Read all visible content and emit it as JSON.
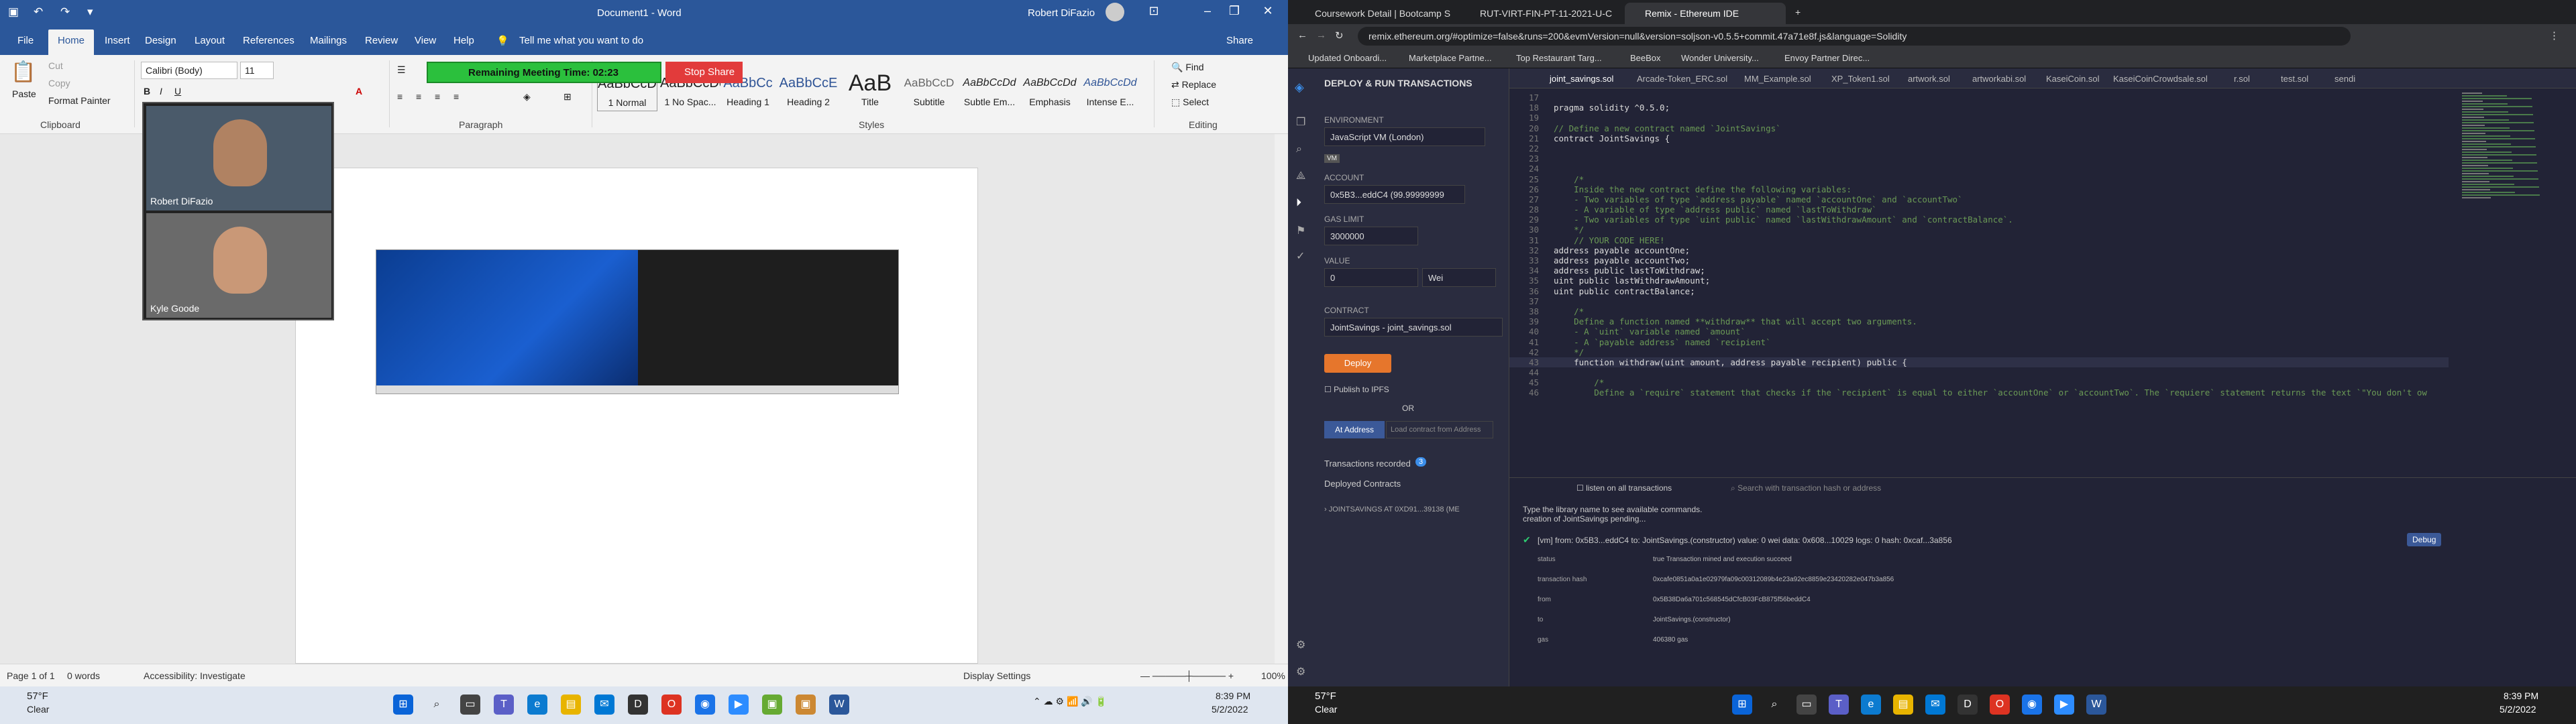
{
  "word": {
    "title": "Document1 - Word",
    "user": "Robert DiFazio",
    "tabs": [
      "File",
      "Home",
      "Insert",
      "Design",
      "Layout",
      "References",
      "Mailings",
      "Review",
      "View",
      "Help"
    ],
    "tell_me": "Tell me what you want to do",
    "share": "Share",
    "clipboard": {
      "paste": "Paste",
      "cut": "Cut",
      "copy": "Copy",
      "format_painter": "Format Painter",
      "group": "Clipboard"
    },
    "font": {
      "name": "Calibri (Body)",
      "size": "11"
    },
    "paragraph_group": "Paragraph",
    "styles_group": "Styles",
    "editing": {
      "find": "Find",
      "replace": "Replace",
      "select": "Select",
      "group": "Editing"
    },
    "styles": [
      {
        "preview": "AaBbCcDc",
        "name": "1 Normal"
      },
      {
        "preview": "AaBbCcDc",
        "name": "1 No Spac..."
      },
      {
        "preview": "AaBbCc",
        "name": "Heading 1"
      },
      {
        "preview": "AaBbCcE",
        "name": "Heading 2"
      },
      {
        "preview": "AaB",
        "name": "Title"
      },
      {
        "preview": "AaBbCcD",
        "name": "Subtitle"
      },
      {
        "preview": "AaBbCcDd",
        "name": "Subtle Em..."
      },
      {
        "preview": "AaBbCcDd",
        "name": "Emphasis"
      },
      {
        "preview": "AaBbCcDd",
        "name": "Intense E..."
      }
    ],
    "meeting_time": "Remaining Meeting Time: 02:23",
    "stop_share": "Stop Share",
    "participants": [
      "Robert DiFazio",
      "Kyle Goode"
    ],
    "status": {
      "page": "Page 1 of 1",
      "words": "0 words",
      "accessibility": "Accessibility: Investigate",
      "display": "Display Settings",
      "zoom": "100%"
    }
  },
  "taskbar_left": {
    "weather_temp": "57°F",
    "weather_desc": "Clear",
    "time": "8:39 PM",
    "date": "5/2/2022"
  },
  "taskbar_right": {
    "weather_temp": "57°F",
    "weather_desc": "Clear",
    "time": "8:39 PM",
    "date": "5/2/2022"
  },
  "chrome": {
    "tabs": [
      "Coursework Detail | Bootcamp S",
      "RUT-VIRT-FIN-PT-11-2021-U-C",
      "Remix - Ethereum IDE"
    ],
    "url": "remix.ethereum.org/#optimize=false&runs=200&evmVersion=null&version=soljson-v0.5.5+commit.47a71e8f.js&language=Solidity",
    "bookmarks": [
      "Updated Onboardi...",
      "Marketplace Partne...",
      "Top Restaurant Targ...",
      "BeeBox",
      "Wonder University...",
      "Envoy Partner Direc..."
    ]
  },
  "remix": {
    "panel_title": "DEPLOY & RUN TRANSACTIONS",
    "environment_label": "ENVIRONMENT",
    "environment": "JavaScript VM (London)",
    "vm_badge": "VM",
    "account_label": "ACCOUNT",
    "account": "0x5B3...eddC4 (99.99999999",
    "gas_label": "GAS LIMIT",
    "gas": "3000000",
    "value_label": "VALUE",
    "value": "0",
    "value_unit": "Wei",
    "contract_label": "CONTRACT",
    "contract": "JointSavings - joint_savings.sol",
    "deploy": "Deploy",
    "publish": "Publish to IPFS",
    "or": "OR",
    "at_address": "At Address",
    "load_contract": "Load contract from Address",
    "tx_recorded": "Transactions recorded",
    "tx_count": "3",
    "deployed": "Deployed Contracts",
    "deployed_item": "JOINTSAVINGS AT 0XD91...39138 (ME",
    "editor_tabs": [
      "joint_savings.sol",
      "Arcade-Token_ERC.sol",
      "MM_Example.sol",
      "XP_Token1.sol",
      "artwork.sol",
      "artworkabi.sol",
      "KaseiCoin.sol",
      "KaseiCoinCrowdsale.sol",
      "r.sol",
      "test.sol",
      "sendi"
    ],
    "code": [
      {
        "n": "17",
        "t": ""
      },
      {
        "n": "18",
        "t": "pragma solidity ^0.5.0;",
        "k": "kw"
      },
      {
        "n": "19",
        "t": ""
      },
      {
        "n": "20",
        "t": "// Define a new contract named `JointSavings`",
        "k": "cm"
      },
      {
        "n": "21",
        "t": "contract JointSavings {",
        "k": "kw"
      },
      {
        "n": "22",
        "t": ""
      },
      {
        "n": "23",
        "t": ""
      },
      {
        "n": "24",
        "t": ""
      },
      {
        "n": "25",
        "t": "    /*",
        "k": "cm"
      },
      {
        "n": "26",
        "t": "    Inside the new contract define the following variables:",
        "k": "cm"
      },
      {
        "n": "27",
        "t": "    - Two variables of type `address payable` named `accountOne` and `accountTwo`",
        "k": "cm"
      },
      {
        "n": "28",
        "t": "    - A variable of type `address public` named `lastToWithdraw`",
        "k": "cm"
      },
      {
        "n": "29",
        "t": "    - Two variables of type `uint public` named `lastWithdrawAmount` and `contractBalance`.",
        "k": "cm"
      },
      {
        "n": "30",
        "t": "    */",
        "k": "cm"
      },
      {
        "n": "31",
        "t": "    // YOUR CODE HERE!",
        "k": "cm"
      },
      {
        "n": "32",
        "t": "address payable accountOne;",
        "k": "kw"
      },
      {
        "n": "33",
        "t": "address payable accountTwo;",
        "k": "kw"
      },
      {
        "n": "34",
        "t": "address public lastToWithdraw;",
        "k": "kw"
      },
      {
        "n": "35",
        "t": "uint public lastWithdrawAmount;",
        "k": "kw"
      },
      {
        "n": "36",
        "t": "uint public contractBalance;",
        "k": "kw"
      },
      {
        "n": "37",
        "t": ""
      },
      {
        "n": "38",
        "t": "    /*",
        "k": "cm"
      },
      {
        "n": "39",
        "t": "    Define a function named **withdraw** that will accept two arguments.",
        "k": "cm"
      },
      {
        "n": "40",
        "t": "    - A `uint` variable named `amount`",
        "k": "cm"
      },
      {
        "n": "41",
        "t": "    - A `payable address` named `recipient`",
        "k": "cm"
      },
      {
        "n": "42",
        "t": "    */",
        "k": "cm"
      },
      {
        "n": "43",
        "t": "    function withdraw(uint amount, address payable recipient) public {",
        "k": "kw"
      },
      {
        "n": "44",
        "t": ""
      },
      {
        "n": "45",
        "t": "        /*",
        "k": "cm"
      },
      {
        "n": "46",
        "t": "        Define a `require` statement that checks if the `recipient` is equal to either `accountOne` or `accountTwo`. The `requiere` statement returns the text `\"You don't ow",
        "k": "cm"
      }
    ],
    "terminal": {
      "listen": "listen on all transactions",
      "search": "Search with transaction hash or address",
      "help1": "Type the library name to see available commands.",
      "help2": "creation of JointSavings pending...",
      "vm_line": "[vm]  from: 0x5B3...eddC4 to: JointSavings.(constructor) value: 0 wei data: 0x608...10029 logs: 0 hash: 0xcaf...3a856",
      "debug": "Debug",
      "rows": [
        {
          "k": "status",
          "v": "true Transaction mined and execution succeed"
        },
        {
          "k": "transaction hash",
          "v": "0xcafe0851a0a1e02979fa09c00312089b4e23a92ec8859e23420282e047b3a856"
        },
        {
          "k": "from",
          "v": "0x5B38Da6a701c568545dCfcB03FcB875f56beddC4"
        },
        {
          "k": "to",
          "v": "JointSavings.(constructor)"
        },
        {
          "k": "gas",
          "v": "406380 gas"
        }
      ]
    }
  },
  "colors": {
    "word_blue": "#2b579a",
    "remix_bg": "#222336",
    "deploy_orange": "#e6762c",
    "meeting_green": "#2bc03d",
    "stop_red": "#e23b3b"
  }
}
